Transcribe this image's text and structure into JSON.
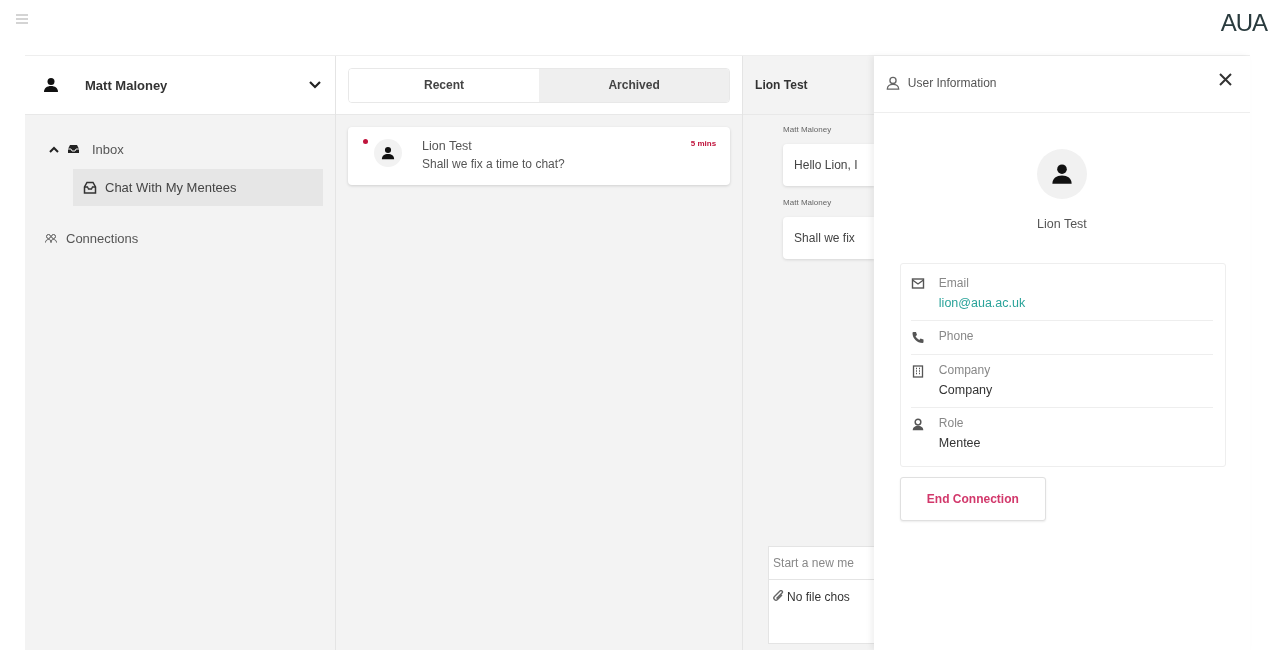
{
  "top_bar": {
    "logo": "AUA"
  },
  "sidebar": {
    "user": {
      "name": "Matt Maloney"
    },
    "items": [
      {
        "label": "Inbox",
        "expanded": true,
        "children": [
          {
            "label": "Chat With My Mentees",
            "selected": true
          }
        ]
      },
      {
        "label": "Connections"
      }
    ]
  },
  "conversations": {
    "tabs": [
      {
        "label": "Recent",
        "selected": true
      },
      {
        "label": "Archived",
        "selected": false
      }
    ],
    "items": [
      {
        "name": "Lion Test",
        "preview": "Shall we fix a time to chat?",
        "time": "5 mins",
        "unread": true
      }
    ]
  },
  "chat": {
    "title": "Lion Test",
    "messages": [
      {
        "sender": "Matt Maloney",
        "text": "Hello Lion, I"
      },
      {
        "sender": "Matt Maloney",
        "text": "Shall we fix"
      }
    ],
    "composer": {
      "placeholder": "Start a new me",
      "file": "No file chos"
    }
  },
  "user_info": {
    "title": "User Information",
    "name": "Lion Test",
    "fields": [
      {
        "kind": "email",
        "label": "Email",
        "value": "lion@aua.ac.uk"
      },
      {
        "kind": "phone",
        "label": "Phone"
      },
      {
        "kind": "company",
        "label": "Company",
        "value": "Company"
      },
      {
        "kind": "role",
        "label": "Role",
        "value": "Mentee"
      }
    ],
    "end_button": "End Connection"
  }
}
